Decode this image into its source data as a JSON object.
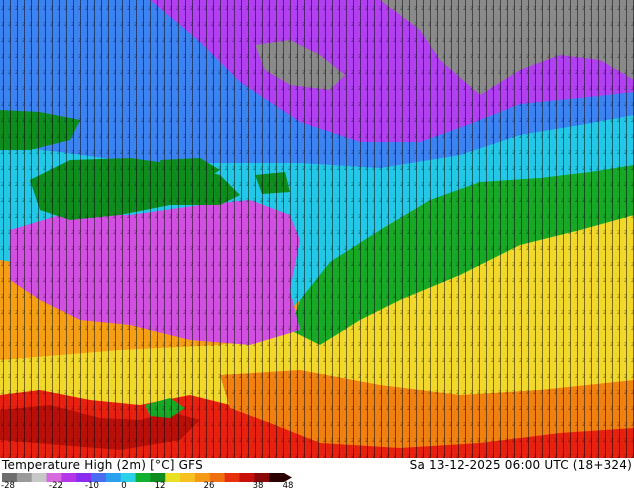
{
  "map": {
    "title": "Temperature High (2m) [°C] GFS",
    "run_info": "Sa 13-12-2025 06:00 UTC (18+324)",
    "colors": {
      "cold_grey": "#8a8a8a",
      "magenta": "#d050e0",
      "violet": "#b040f0",
      "blue": "#3c82f0",
      "cyan": "#22c8e6",
      "green": "#18a828",
      "dark_green": "#0e8c1e",
      "yellow": "#f2d82a",
      "orange": "#f5a014",
      "dark_orange": "#f08010",
      "red": "#e82010",
      "dark_red": "#b81008"
    }
  },
  "legend": {
    "ticks": [
      "-28",
      "-22",
      "-10",
      "0",
      "12",
      "26",
      "38",
      "48"
    ],
    "colors": [
      "#6e6e6e",
      "#9a9a9a",
      "#c8c8c8",
      "#d86ae0",
      "#b436e8",
      "#8a2cf0",
      "#4a6cf0",
      "#2aa0f0",
      "#28d0e8",
      "#10b030",
      "#0e8c1e",
      "#e8e020",
      "#f5c020",
      "#f59a14",
      "#f07010",
      "#e83010",
      "#c81008",
      "#8a0808",
      "#2a0000"
    ]
  }
}
